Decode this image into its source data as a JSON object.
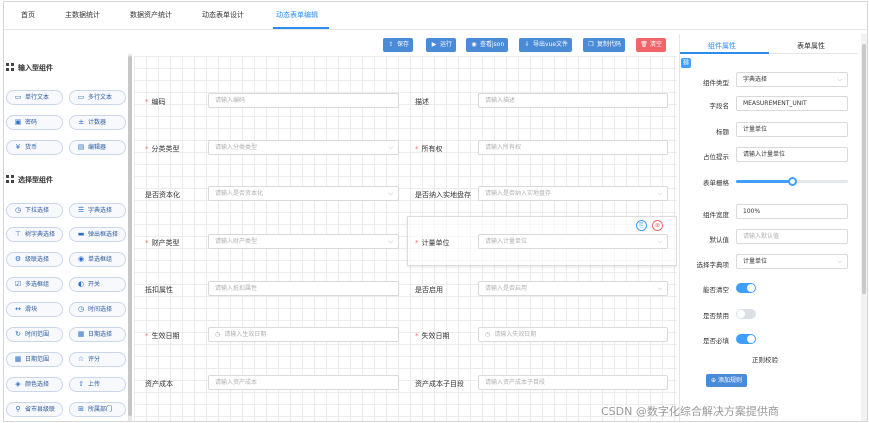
{
  "nav": {
    "tabs": [
      {
        "label": "首页"
      },
      {
        "label": "主数据统计"
      },
      {
        "label": "数据资产统计"
      },
      {
        "label": "动态表单设计"
      },
      {
        "label": "动态表单编辑",
        "active": true
      }
    ]
  },
  "palette": {
    "input_group": "输入型组件",
    "input_components": [
      {
        "label": "单行文本",
        "icon": "single-line-text-icon"
      },
      {
        "label": "多行文本",
        "icon": "multi-line-text-icon"
      },
      {
        "label": "密码",
        "icon": "password-icon"
      },
      {
        "label": "计数器",
        "icon": "counter-icon"
      },
      {
        "label": "货币",
        "icon": "currency-icon"
      },
      {
        "label": "编辑器",
        "icon": "editor-icon"
      }
    ],
    "select_group": "选择型组件",
    "select_components": [
      {
        "label": "下拉选择",
        "icon": "dropdown-icon"
      },
      {
        "label": "字典选择",
        "icon": "dictionary-icon"
      },
      {
        "label": "树字典选择",
        "icon": "tree-dictionary-icon"
      },
      {
        "label": "弹出框选择",
        "icon": "popup-select-icon"
      },
      {
        "label": "级联选择",
        "icon": "cascader-icon"
      },
      {
        "label": "单选框组",
        "icon": "radio-group-icon"
      },
      {
        "label": "多选框组",
        "icon": "checkbox-group-icon"
      },
      {
        "label": "开关",
        "icon": "switch-icon"
      },
      {
        "label": "滑块",
        "icon": "slider-icon"
      },
      {
        "label": "时间选择",
        "icon": "time-picker-icon"
      },
      {
        "label": "时间范围",
        "icon": "time-range-icon"
      },
      {
        "label": "日期选择",
        "icon": "date-picker-icon"
      },
      {
        "label": "日期范围",
        "icon": "date-range-icon"
      },
      {
        "label": "评分",
        "icon": "rate-icon"
      },
      {
        "label": "颜色选择",
        "icon": "color-picker-icon"
      },
      {
        "label": "上传",
        "icon": "upload-icon"
      },
      {
        "label": "省市县级联",
        "icon": "region-cascader-icon"
      },
      {
        "label": "所属部门",
        "icon": "department-icon"
      }
    ]
  },
  "toolbar": {
    "save": "保存",
    "run": "运行",
    "view_json": "查看json",
    "export_vue": "导出vue文件",
    "copy_code": "复制代码",
    "clear": "清空"
  },
  "form": {
    "code_label": "编码",
    "code_ph": "请输入编码",
    "desc_label": "描述",
    "desc_ph": "请输入描述",
    "category_label": "分类类型",
    "category_ph": "请输入分类类型",
    "owner_label": "所有权",
    "owner_ph": "请输入所有权",
    "is_asset_label": "是否资本化",
    "is_asset_ph": "请输入是否资本化",
    "is_inventory_label": "是否纳入实地盘存",
    "is_inventory_ph": "请输入是否纳入实地盘存",
    "fin_type_label": "财产类型",
    "fin_type_ph": "请输入财产类型",
    "unit_label": "计量单位",
    "unit_ph": "请输入计量单位",
    "deduct_label": "抵扣属性",
    "deduct_ph": "请输入抵扣属性",
    "enabled_label": "是否启用",
    "enabled_ph": "请输入是否启用",
    "start_label": "生效日期",
    "start_ph": "请输入生效日期",
    "end_label": "失效日期",
    "end_ph": "请输入失效日期",
    "cost_label": "资产成本",
    "cost_ph": "请输入资产成本",
    "cost_sub_label": "资产成本子目段",
    "cost_sub_ph": "请输入资产成本子目段"
  },
  "props": {
    "tab_component": "组件属性",
    "tab_form": "表单属性",
    "type_label": "组件类型",
    "type_value": "字典选择",
    "field_label": "字段名",
    "field_value": "MEASUREMENT_UNIT",
    "title_label": "标题",
    "title_value": "计量单位",
    "placeholder_label": "占位提示",
    "placeholder_value": "请输入计量单位",
    "grid_label": "表单栅格",
    "grid_value": 0.5,
    "width_label": "组件宽度",
    "width_value": "100%",
    "default_label": "默认值",
    "default_ph": "请输入默认值",
    "dict_label": "选择字典项",
    "dict_value": "计量单位",
    "clearable_label": "能否清空",
    "clearable": true,
    "disabled_label": "是否禁用",
    "disabled": false,
    "required_label": "是否必填",
    "required": true,
    "regex_title": "正则校验",
    "add_rule": "添加规则"
  },
  "watermark": "CSDN @数字化综合解决方案提供商",
  "colors": {
    "accent": "#409eff",
    "danger": "#f56c6c",
    "button": "#4a8bd8"
  }
}
